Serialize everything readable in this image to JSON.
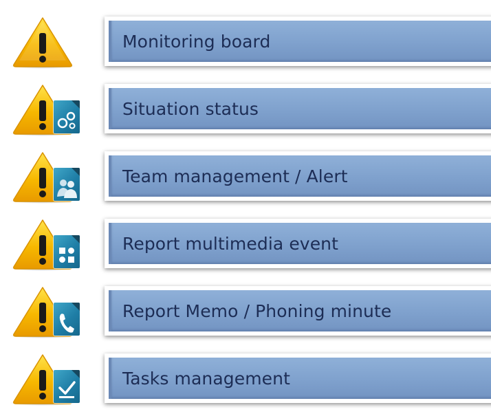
{
  "menu": {
    "items": [
      {
        "label": "Monitoring  board",
        "icon": "warning-icon",
        "badge": ""
      },
      {
        "label": "Situation  status",
        "icon": "warning-icon",
        "badge": "gears-icon"
      },
      {
        "label": "Team management / Alert",
        "icon": "warning-icon",
        "badge": "team-icon"
      },
      {
        "label": "Report multimedia event",
        "icon": "warning-icon",
        "badge": "multimedia-icon"
      },
      {
        "label": "Report Memo / Phoning minute",
        "icon": "warning-icon",
        "badge": "phone-icon"
      },
      {
        "label": "Tasks management",
        "icon": "warning-icon",
        "badge": "tasks-icon"
      }
    ]
  },
  "colors": {
    "warning_yellow": "#f6b400",
    "button_blue": "#8aaad4",
    "badge_teal": "#2a8fb6",
    "label_text": "#1d2d55"
  }
}
